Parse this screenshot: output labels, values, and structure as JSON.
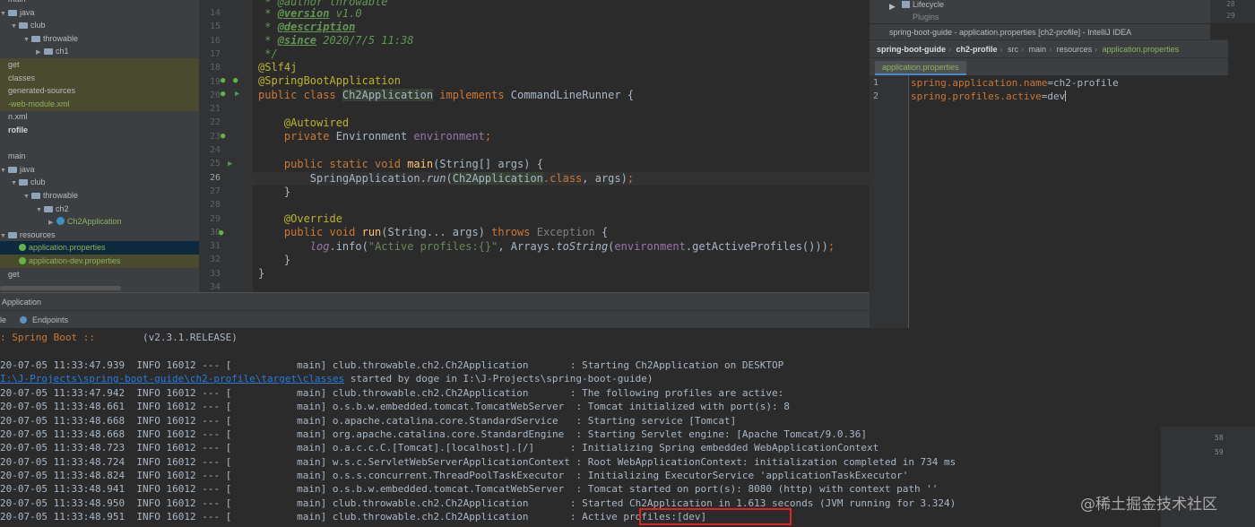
{
  "tree": {
    "rows": [
      {
        "text": "main",
        "indent": 0,
        "arrow": "",
        "icon": "none",
        "style": ""
      },
      {
        "text": "java",
        "indent": 0,
        "arrow": "▼",
        "icon": "folder",
        "style": ""
      },
      {
        "text": "club",
        "indent": 12,
        "arrow": "▼",
        "icon": "folder",
        "style": ""
      },
      {
        "text": "throwable",
        "indent": 26,
        "arrow": "▼",
        "icon": "folder",
        "style": ""
      },
      {
        "text": "ch1",
        "indent": 40,
        "arrow": "▶",
        "icon": "folder",
        "style": ""
      },
      {
        "text": "get",
        "indent": 0,
        "arrow": "",
        "icon": "none",
        "style": "hl-yellow"
      },
      {
        "text": "classes",
        "indent": 0,
        "arrow": "",
        "icon": "none",
        "style": "hl-yellow"
      },
      {
        "text": "generated-sources",
        "indent": 0,
        "arrow": "",
        "icon": "none",
        "style": "hl-yellow"
      },
      {
        "text": "-web-module.xml",
        "indent": 0,
        "arrow": "",
        "icon": "none",
        "style": "hl-yellow green"
      },
      {
        "text": "n.xml",
        "indent": 0,
        "arrow": "",
        "icon": "none",
        "style": ""
      },
      {
        "text": "rofile",
        "indent": 0,
        "arrow": "",
        "icon": "none",
        "style": "bold"
      },
      {
        "text": "",
        "indent": 0,
        "arrow": "",
        "icon": "none",
        "style": ""
      },
      {
        "text": "main",
        "indent": 0,
        "arrow": "",
        "icon": "none",
        "style": ""
      },
      {
        "text": "java",
        "indent": 0,
        "arrow": "▼",
        "icon": "folder",
        "style": ""
      },
      {
        "text": "club",
        "indent": 12,
        "arrow": "▼",
        "icon": "folder",
        "style": ""
      },
      {
        "text": "throwable",
        "indent": 26,
        "arrow": "▼",
        "icon": "folder",
        "style": ""
      },
      {
        "text": "ch2",
        "indent": 40,
        "arrow": "▼",
        "icon": "folder",
        "style": ""
      },
      {
        "text": "Ch2Application",
        "indent": 54,
        "arrow": "▶",
        "icon": "class",
        "style": "green"
      },
      {
        "text": "resources",
        "indent": 0,
        "arrow": "▼",
        "icon": "folder",
        "style": ""
      },
      {
        "text": "application.properties",
        "indent": 12,
        "arrow": "",
        "icon": "leaf",
        "style": "hl-blue green"
      },
      {
        "text": "application-dev.properties",
        "indent": 12,
        "arrow": "",
        "icon": "leaf",
        "style": "hl-yellow green"
      },
      {
        "text": "get",
        "indent": 0,
        "arrow": "",
        "icon": "none",
        "style": ""
      },
      {
        "text": "",
        "indent": 0,
        "arrow": "",
        "icon": "none",
        "style": ""
      }
    ]
  },
  "editor": {
    "line_numbers": [
      "14",
      "15",
      "16",
      "17",
      "18",
      "19",
      "20",
      "21",
      "22",
      "23",
      "24",
      "25",
      "26",
      "27",
      "28",
      "29",
      "30",
      "31",
      "32",
      "33",
      "34"
    ],
    "current_line": "26"
  },
  "float_window": {
    "top_strip_item1": "Lifecycle",
    "top_strip_item2": "Plugins",
    "title": "spring-boot-guide - application.properties [ch2-profile] - IntelliJ IDEA",
    "breadcrumbs": [
      "spring-boot-guide",
      "ch2-profile",
      "src",
      "main",
      "resources",
      "application.properties"
    ],
    "tab": "application.properties",
    "lines": [
      {
        "num": "1",
        "key": "spring.application.name",
        "value": "ch2-profile"
      },
      {
        "num": "2",
        "key": "spring.profiles.active",
        "value": "dev"
      }
    ],
    "right_numbers": [
      "28",
      "29"
    ]
  },
  "run_window": {
    "header": "Application",
    "tab_console": "le",
    "tab_endpoints": "Endpoints"
  },
  "console": {
    "banner_prefix": ": Spring Boot ::",
    "banner_version": "(v2.3.1.RELEASE)",
    "lines": [
      {
        "time": "20-07-05 11:33:47.939",
        "level": "INFO",
        "pid": "16012",
        "thread": "main",
        "logger": "club.throwable.ch2.Ch2Application      ",
        "msg": ": Starting Ch2Application on DESKTOP"
      },
      {
        "time": "20-07-05 11:33:47.942",
        "level": "INFO",
        "pid": "16012",
        "thread": "main",
        "logger": "club.throwable.ch2.Ch2Application      ",
        "msg": ": The following profiles are active:"
      },
      {
        "time": "20-07-05 11:33:48.661",
        "level": "INFO",
        "pid": "16012",
        "thread": "main",
        "logger": "o.s.b.w.embedded.tomcat.TomcatWebServer ",
        "msg": ": Tomcat initialized with port(s): 8"
      },
      {
        "time": "20-07-05 11:33:48.668",
        "level": "INFO",
        "pid": "16012",
        "thread": "main",
        "logger": "o.apache.catalina.core.StandardService  ",
        "msg": ": Starting service [Tomcat]"
      },
      {
        "time": "20-07-05 11:33:48.668",
        "level": "INFO",
        "pid": "16012",
        "thread": "main",
        "logger": "org.apache.catalina.core.StandardEngine ",
        "msg": ": Starting Servlet engine: [Apache Tomcat/9.0.36]"
      },
      {
        "time": "20-07-05 11:33:48.723",
        "level": "INFO",
        "pid": "16012",
        "thread": "main",
        "logger": "o.a.c.c.C.[Tomcat].[localhost].[/]     ",
        "msg": ": Initializing Spring embedded WebApplicationContext"
      },
      {
        "time": "20-07-05 11:33:48.724",
        "level": "INFO",
        "pid": "16012",
        "thread": "main",
        "logger": "w.s.c.ServletWebServerApplicationContext",
        "msg": ": Root WebApplicationContext: initialization completed in 734 ms"
      },
      {
        "time": "20-07-05 11:33:48.824",
        "level": "INFO",
        "pid": "16012",
        "thread": "main",
        "logger": "o.s.s.concurrent.ThreadPoolTaskExecutor ",
        "msg": ": Initializing ExecutorService 'applicationTaskExecutor'"
      },
      {
        "time": "20-07-05 11:33:48.941",
        "level": "INFO",
        "pid": "16012",
        "thread": "main",
        "logger": "o.s.b.w.embedded.tomcat.TomcatWebServer ",
        "msg": ": Tomcat started on port(s): 8080 (http) with context path ''"
      },
      {
        "time": "20-07-05 11:33:48.950",
        "level": "INFO",
        "pid": "16012",
        "thread": "main",
        "logger": "club.throwable.ch2.Ch2Application      ",
        "msg": ": Started Ch2Application in 1.613 seconds (JVM running for 3.324)"
      },
      {
        "time": "20-07-05 11:33:48.951",
        "level": "INFO",
        "pid": "16012",
        "thread": "main",
        "logger": "club.throwable.ch2.Ch2Application      ",
        "msg": ": Active profiles:[dev]"
      }
    ],
    "classpath_line": "I:\\J-Projects\\spring-boot-guide\\ch2-profile\\target\\classes",
    "classpath_suffix": " started by doge in I:\\J-Projects\\spring-boot-guide)",
    "highlighted_text": "Active profiles:[dev]"
  },
  "right_gutter_numbers": [
    "58",
    "59"
  ],
  "watermark": "@稀土掘金技术社区",
  "colors": {
    "background": "#2b2b2b",
    "keyword": "#cc7832",
    "annotation": "#bbb529",
    "string": "#6a8759",
    "highlight_box": "#e02424"
  }
}
